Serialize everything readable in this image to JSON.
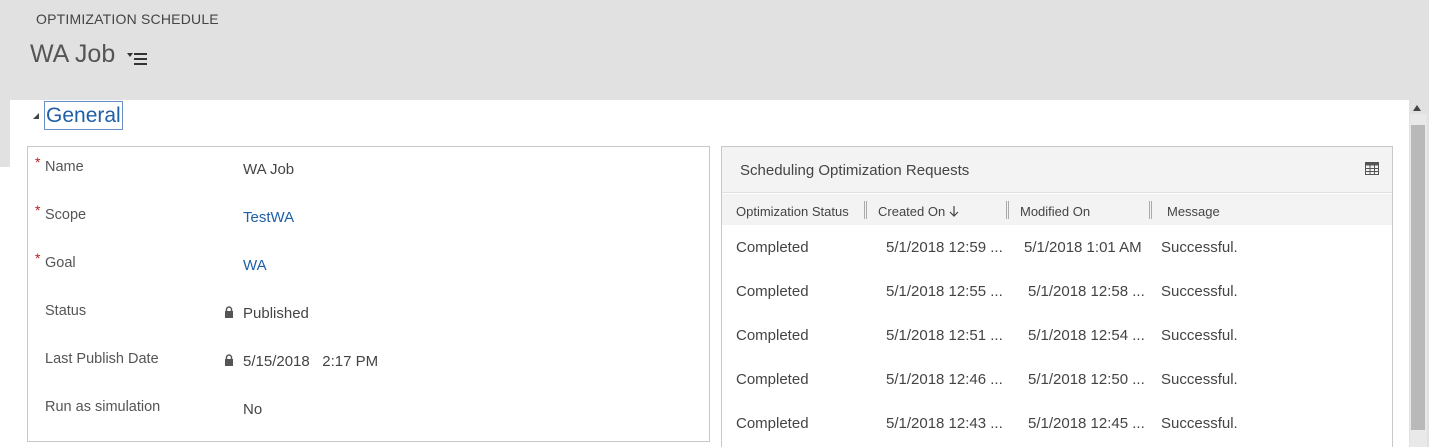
{
  "header": {
    "entity_type": "OPTIMIZATION SCHEDULE",
    "record_title": "WA Job"
  },
  "section": {
    "title": "General"
  },
  "form": {
    "fields": [
      {
        "label": "Name",
        "value": "WA Job",
        "required": true,
        "locked": false,
        "link": false
      },
      {
        "label": "Scope",
        "value": "TestWA",
        "required": true,
        "locked": false,
        "link": true
      },
      {
        "label": "Goal",
        "value": "WA",
        "required": true,
        "locked": false,
        "link": true
      },
      {
        "label": "Status",
        "value": "Published",
        "required": false,
        "locked": true,
        "link": false
      },
      {
        "label": "Last Publish Date",
        "value": "5/15/2018   2:17 PM",
        "required": false,
        "locked": true,
        "link": false
      },
      {
        "label": "Run as simulation",
        "value": "No",
        "required": false,
        "locked": false,
        "link": false
      }
    ]
  },
  "grid": {
    "title": "Scheduling Optimization Requests",
    "columns": [
      "Optimization Status",
      "Created On",
      "Modified On",
      "Message"
    ],
    "rows": [
      [
        "Completed",
        "5/1/2018 12:59 ...",
        "5/1/2018 1:01 AM",
        "Successful."
      ],
      [
        "Completed",
        "5/1/2018 12:55 ...",
        "5/1/2018 12:58 ...",
        "Successful."
      ],
      [
        "Completed",
        "5/1/2018 12:51 ...",
        "5/1/2018 12:54 ...",
        "Successful."
      ],
      [
        "Completed",
        "5/1/2018 12:46 ...",
        "5/1/2018 12:50 ...",
        "Successful."
      ],
      [
        "Completed",
        "5/1/2018 12:43 ...",
        "5/1/2018 12:45 ...",
        "Successful."
      ]
    ]
  },
  "icons": {
    "title_menu": "list-menu-icon",
    "section_toggle": "collapse-triangle-icon",
    "lock": "lock-icon",
    "grid_view": "grid-view-icon",
    "sort": "sort-down-arrow-icon"
  },
  "colors": {
    "header_bg": "#e1e1e1",
    "link": "#1f5fa8",
    "required": "#b01e1e"
  }
}
